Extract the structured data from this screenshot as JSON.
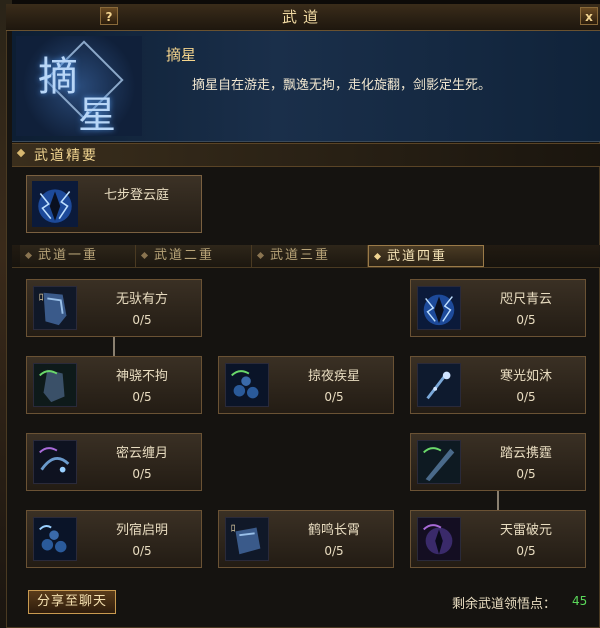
{
  "window": {
    "title": "武道",
    "help_label": "?",
    "close_label": "x"
  },
  "header": {
    "emblem_chars": [
      "摘",
      "星"
    ],
    "name": "摘星",
    "description": "摘星自在游走，飘逸无拘，走化旋翻，剑影定生死。"
  },
  "section": {
    "title": "武道精要"
  },
  "featured": {
    "name": "七步登云庭",
    "icon": "lightning-figure-icon"
  },
  "tabs": [
    {
      "label": "武道一重",
      "active": false
    },
    {
      "label": "武道二重",
      "active": false
    },
    {
      "label": "武道三重",
      "active": false
    },
    {
      "label": "武道四重",
      "active": true
    }
  ],
  "skills": [
    {
      "name": "无驮有方",
      "points": "0/5",
      "icon": "leg-armor-icon"
    },
    {
      "name": "咫尺青云",
      "points": "0/5",
      "icon": "lightning-figure-icon"
    },
    {
      "name": "神骁不拘",
      "points": "0/5",
      "icon": "boot-green-icon"
    },
    {
      "name": "掠夜疾星",
      "points": "0/5",
      "icon": "blue-orbs-icon"
    },
    {
      "name": "寒光如沐",
      "points": "0/5",
      "icon": "sparkle-figure-icon"
    },
    {
      "name": "密云缠月",
      "points": "0/5",
      "icon": "purple-swirl-icon"
    },
    {
      "name": "踏云携霆",
      "points": "0/5",
      "icon": "blade-icon"
    },
    {
      "name": "列宿启明",
      "points": "0/5",
      "icon": "blue-orbs-icon"
    },
    {
      "name": "鹤鸣长霄",
      "points": "0/5",
      "icon": "blue-bracer-icon"
    },
    {
      "name": "天雷破元",
      "points": "0/5",
      "icon": "purple-figure-icon"
    }
  ],
  "footer": {
    "share_label": "分享至聊天",
    "remaining_label": "剩余武道领悟点：",
    "remaining_value": "45"
  },
  "colors": {
    "accent_gold": "#f0d490",
    "remaining_green": "#5ad85a",
    "header_blue": "#1a2f4a"
  }
}
